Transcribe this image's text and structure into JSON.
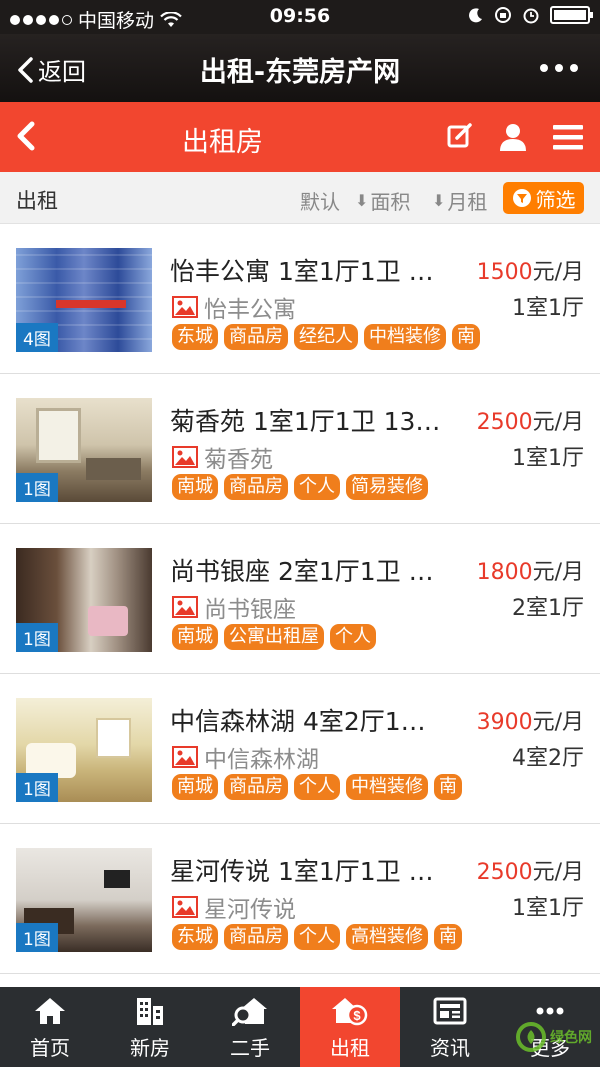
{
  "status_bar": {
    "carrier": "中国移动",
    "time": "09:56"
  },
  "wechat_header": {
    "back_label": "返回",
    "title": "出租-东莞房产网"
  },
  "page_header": {
    "title": "出租房"
  },
  "filter_bar": {
    "category": "出租",
    "sort_default": "默认",
    "sort_area": "面积",
    "sort_rent": "月租",
    "filter_label": "筛选"
  },
  "listings": [
    {
      "title": "怡丰公寓 1室1厅1卫 …",
      "price": "1500",
      "price_unit": "元/月",
      "estate": "怡丰公寓",
      "layout": "1室1厅",
      "photo_count": "4图",
      "tags": [
        "东城",
        "商品房",
        "经纪人",
        "中档装修",
        "南"
      ]
    },
    {
      "title": "菊香苑 1室1厅1卫 13…",
      "price": "2500",
      "price_unit": "元/月",
      "estate": "菊香苑",
      "layout": "1室1厅",
      "photo_count": "1图",
      "tags": [
        "南城",
        "商品房",
        "个人",
        "简易装修"
      ]
    },
    {
      "title": "尚书银座 2室1厅1卫 …",
      "price": "1800",
      "price_unit": "元/月",
      "estate": "尚书银座",
      "layout": "2室1厅",
      "photo_count": "1图",
      "tags": [
        "南城",
        "公寓出租屋",
        "个人"
      ]
    },
    {
      "title": "中信森林湖 4室2厅1…",
      "price": "3900",
      "price_unit": "元/月",
      "estate": "中信森林湖",
      "layout": "4室2厅",
      "photo_count": "1图",
      "tags": [
        "南城",
        "商品房",
        "个人",
        "中档装修",
        "南"
      ]
    },
    {
      "title": "星河传说 1室1厅1卫 …",
      "price": "2500",
      "price_unit": "元/月",
      "estate": "星河传说",
      "layout": "1室1厅",
      "photo_count": "1图",
      "tags": [
        "东城",
        "商品房",
        "个人",
        "高档装修",
        "南"
      ]
    }
  ],
  "tab_bar": [
    {
      "label": "首页",
      "icon": "home-icon"
    },
    {
      "label": "新房",
      "icon": "building-icon"
    },
    {
      "label": "二手",
      "icon": "house-search-icon"
    },
    {
      "label": "出租",
      "icon": "rent-house-icon",
      "active": true
    },
    {
      "label": "资讯",
      "icon": "news-icon"
    },
    {
      "label": "更多",
      "icon": "more-icon"
    }
  ],
  "watermark": {
    "text": "绿色网"
  },
  "colors": {
    "accent_red": "#f2462f",
    "tag_orange": "#f07e1c",
    "price_red": "#e83a2a",
    "photo_badge_blue": "#1a78c2",
    "tab_bg": "#2b2e31"
  }
}
